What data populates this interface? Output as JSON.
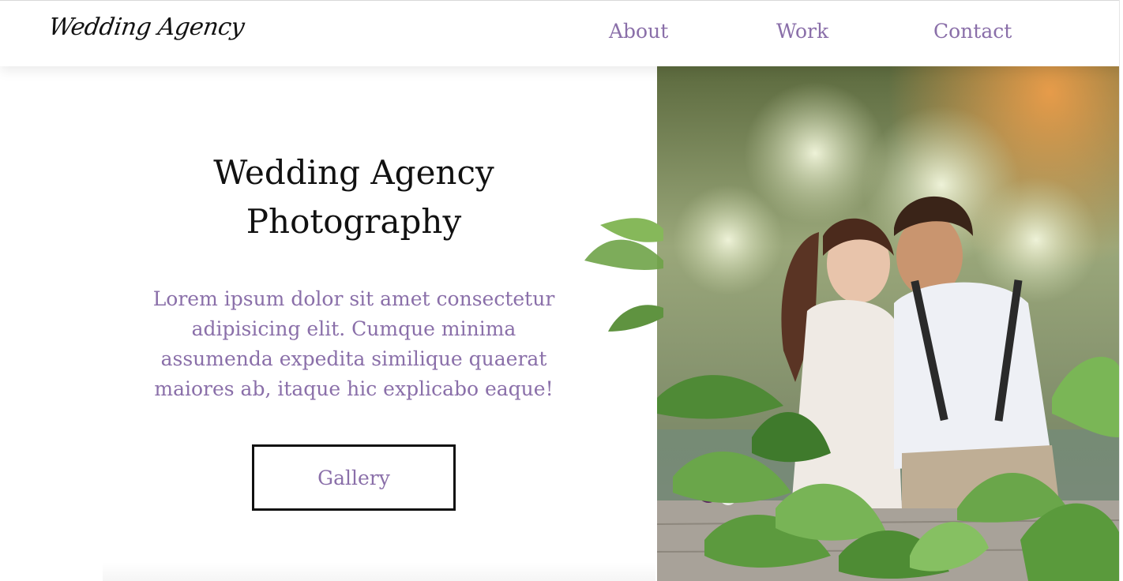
{
  "header": {
    "logo_text": "Wedding Agency",
    "nav": [
      {
        "label": "About"
      },
      {
        "label": "Work"
      },
      {
        "label": "Contact"
      }
    ]
  },
  "hero": {
    "title_line1": "Wedding Agency",
    "title_line2": "Photography",
    "description": "Lorem ipsum dolor sit amet consectetur adipisicing elit. Cumque minima assumenda expedita similique quaerat maiores ab, itaque hic explicabo eaque!",
    "button_label": "Gallery"
  },
  "colors": {
    "accent": "#8a6fa9",
    "heading": "#111111",
    "background": "#ffffff"
  }
}
